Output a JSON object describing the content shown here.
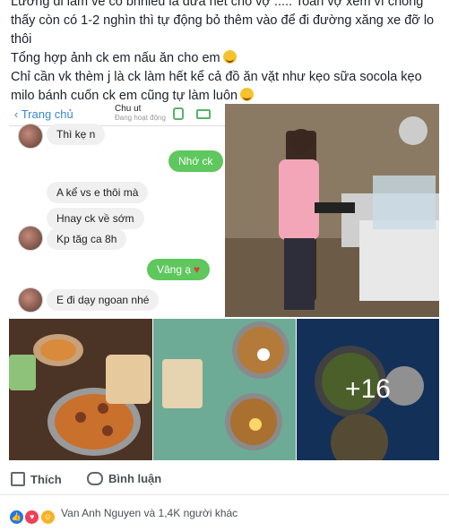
{
  "post": {
    "lines": [
      "Lương đi làm về có bnhiêu là đưa hết cho vợ ..... Toàn vợ xem ví chồng",
      "thấy còn có 1-2 nghìn thì tự động bỏ thêm vào để đi đường xăng xe đỡ lo",
      "thôi",
      "Tổng hợp ảnh ck em nấu ăn cho em",
      "Chỉ cần vk thèm j là ck làm hết kể cả đồ ăn vặt như kẹo sữa socola kẹo",
      "milo bánh cuốn ck em cũng tự làm luôn"
    ]
  },
  "chat": {
    "back": "Trang chủ",
    "title": "Chu ut",
    "subtitle": "Đang hoạt động",
    "messages": [
      {
        "text": "Thì kẹ n"
      },
      {
        "text": "Nhớ ck"
      },
      {
        "text": "A kể vs e thôi mà"
      },
      {
        "text": "Hnay ck về sớm"
      },
      {
        "text": "Kp tăg ca 8h"
      },
      {
        "text": "Vâng ạ"
      },
      {
        "text": "E đi dạy ngoan nhé"
      }
    ]
  },
  "gallery": {
    "more": "+16"
  },
  "actions": {
    "like": "Thích",
    "comment": "Bình luận"
  },
  "reactions": {
    "text": "Van Anh Nguyen và 1,4K người khác"
  },
  "colors": {
    "accent": "#5ec75d",
    "link": "#3a87d8",
    "like_blue": "#1877f2"
  }
}
